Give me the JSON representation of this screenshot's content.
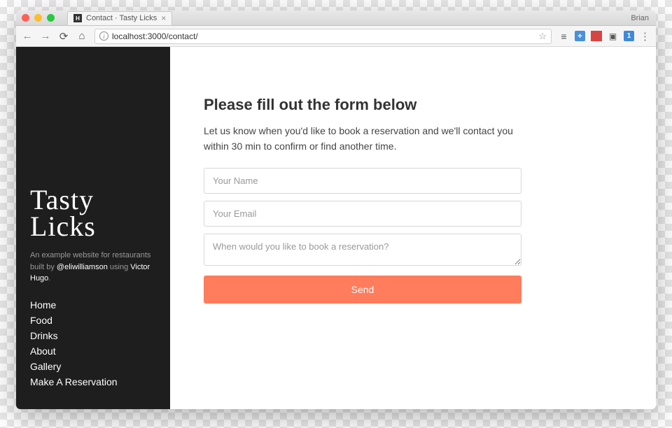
{
  "browser": {
    "tab_title": "Contact · Tasty Licks",
    "profile": "Brian",
    "url": "localhost:3000/contact/"
  },
  "sidebar": {
    "logo_line1": "Tasty",
    "logo_line2": "Licks",
    "tagline_prefix": "An example website for restaurants built by ",
    "tagline_handle": "@eliwilliamson",
    "tagline_mid": " using ",
    "tagline_hugo": "Victor Hugo",
    "tagline_suffix": ".",
    "nav": [
      {
        "label": "Home"
      },
      {
        "label": "Food"
      },
      {
        "label": "Drinks"
      },
      {
        "label": "About"
      },
      {
        "label": "Gallery"
      },
      {
        "label": "Make A Reservation"
      }
    ]
  },
  "form": {
    "heading": "Please fill out the form below",
    "subtext": "Let us know when you'd like to book a reservation and we'll contact you within 30 min to confirm or find another time.",
    "name_placeholder": "Your Name",
    "email_placeholder": "Your Email",
    "message_placeholder": "When would you like to book a reservation?",
    "submit_label": "Send"
  }
}
